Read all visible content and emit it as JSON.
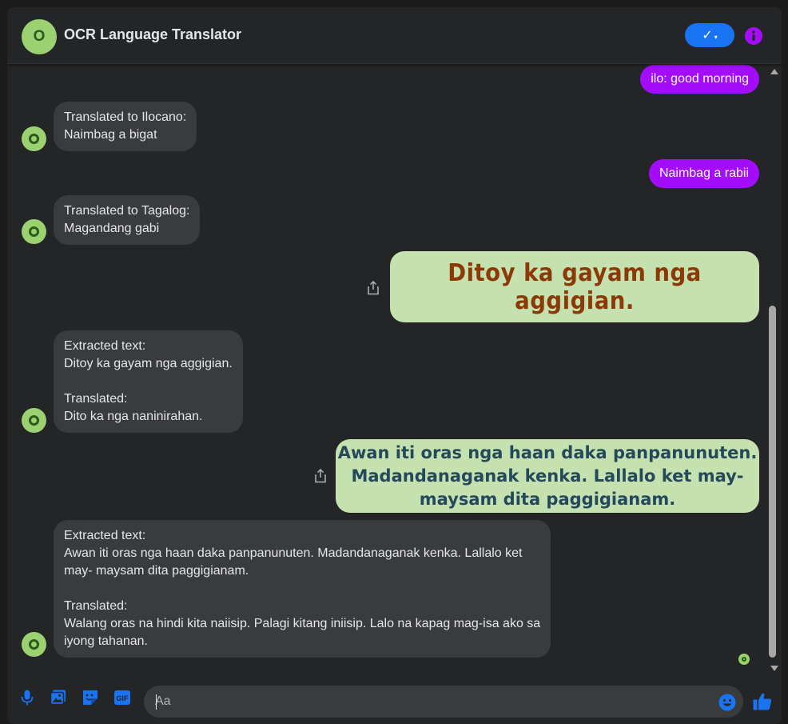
{
  "header": {
    "title": "OCR Language Translator",
    "avatar_letter": "O",
    "verify_glyph": "✓",
    "verify_caret": "▾"
  },
  "messages": [
    {
      "type": "outgoing",
      "text": "ilo: good morning"
    },
    {
      "type": "incoming",
      "text": "Translated to Ilocano:\nNaimbag a bigat"
    },
    {
      "type": "outgoing",
      "text": "Naimbag a rabii"
    },
    {
      "type": "incoming",
      "text": "Translated to Tagalog:\nMagandang gabi"
    },
    {
      "type": "outgoing-image",
      "image_text": "Ditoy ka gayam nga aggigian."
    },
    {
      "type": "incoming",
      "text": "Extracted text:\nDitoy ka gayam nga aggigian.\n\nTranslated:\nDito ka nga naninirahan."
    },
    {
      "type": "outgoing-image",
      "image_text": "Awan iti oras nga haan daka panpanunuten.\nMadandanaganak kenka. Lallalo ket may-\nmaysam dita paggigianam."
    },
    {
      "type": "incoming",
      "text": "Extracted text:\nAwan iti oras nga haan daka panpanunuten. Madandanaganak kenka. Lallalo ket\nmay- maysam dita paggigianam.\n\nTranslated:\nWalang oras na hindi kita naiisip. Palagi kitang iniisip. Lalo na kapag mag-isa ako sa\niyong tahanan."
    }
  ],
  "composer": {
    "placeholder": "Aa",
    "gif_label": "GIF"
  },
  "colors": {
    "accent_blue": "#1874f2",
    "outgoing_bubble": "#a30dfc",
    "incoming_bubble": "#3a3b3c",
    "avatar_green": "#9bd170"
  },
  "icons": [
    "microphone-icon",
    "photo-icon",
    "sticker-icon",
    "gif-icon",
    "emoji-icon",
    "like-icon",
    "info-icon",
    "share-icon"
  ]
}
